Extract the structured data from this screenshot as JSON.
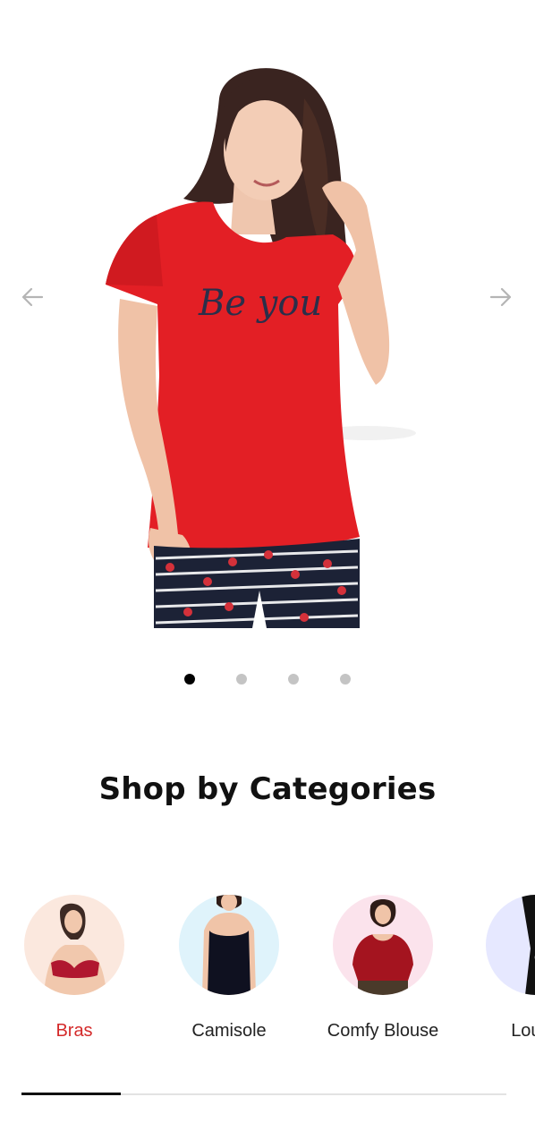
{
  "carousel": {
    "slides": [
      {
        "label": "slide-1"
      },
      {
        "label": "slide-2"
      },
      {
        "label": "slide-3"
      },
      {
        "label": "slide-4"
      }
    ],
    "active_index": 0,
    "tshirt_text": "Be you"
  },
  "section": {
    "title": "Shop by Categories"
  },
  "categories": [
    {
      "label": "Bras",
      "active": true
    },
    {
      "label": "Camisole",
      "active": false
    },
    {
      "label": "Comfy Blouse",
      "active": false
    },
    {
      "label": "Loung",
      "active": false
    }
  ],
  "colors": {
    "accent": "#d42a2a",
    "dot_active": "#000000",
    "dot_inactive": "#c4c4c4"
  }
}
